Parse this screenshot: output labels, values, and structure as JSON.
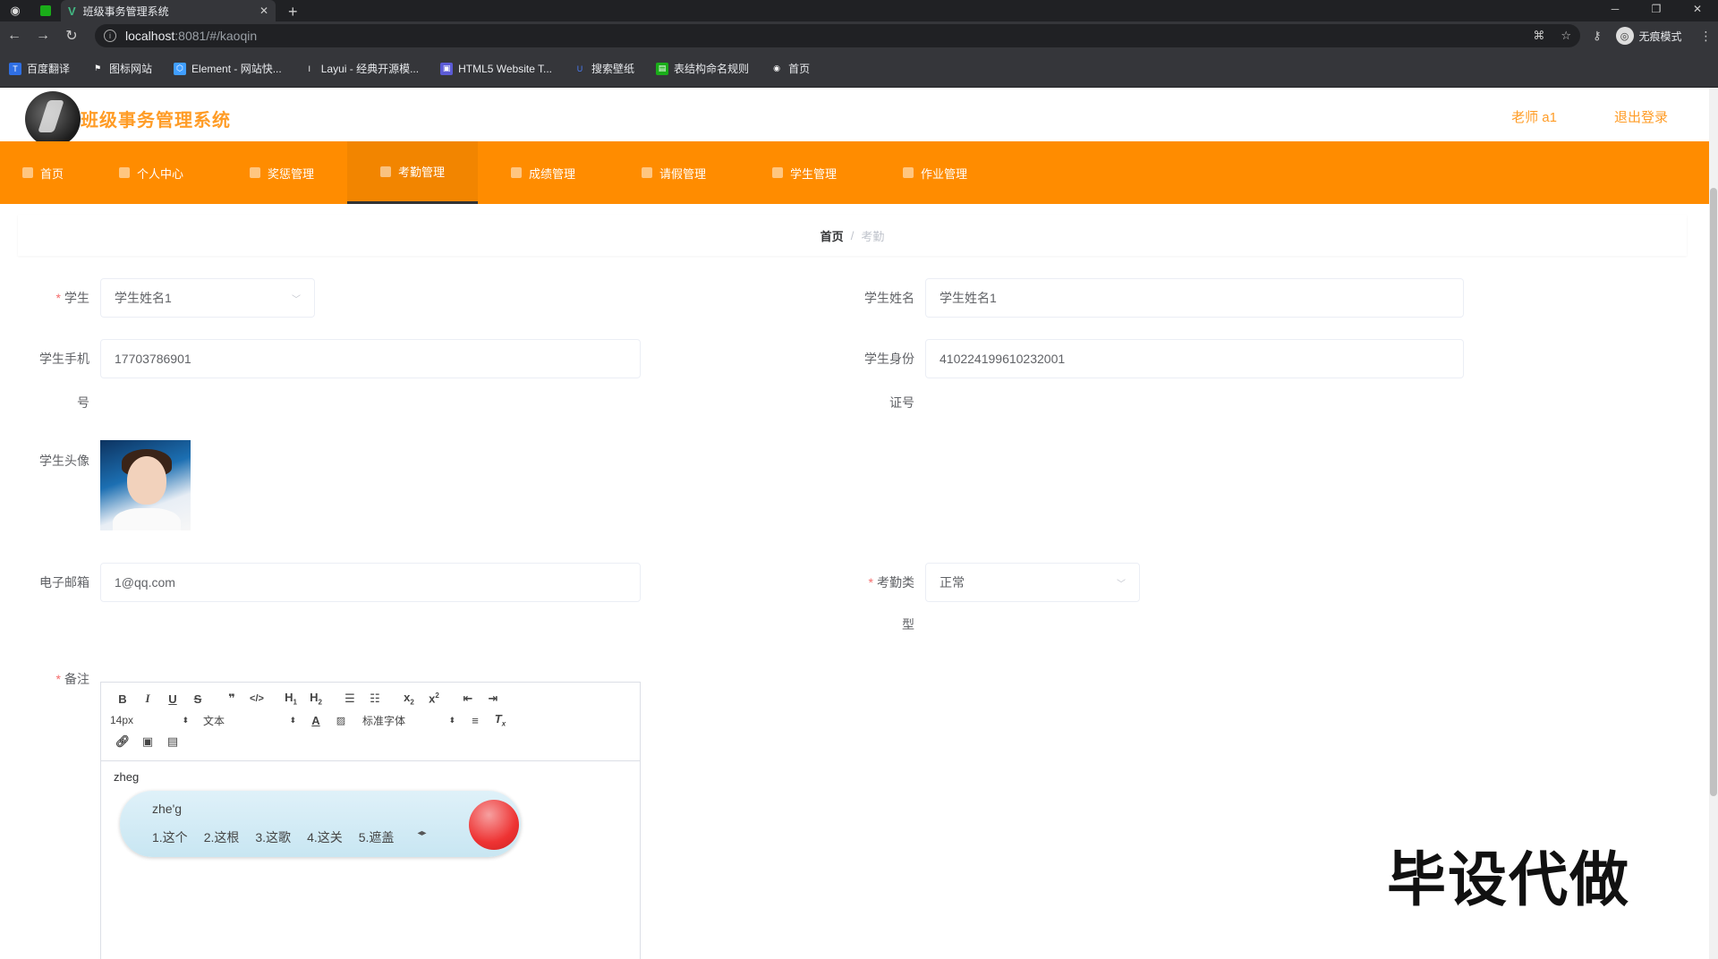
{
  "browser": {
    "tab_title": "班级事务管理系统",
    "url_host": "localhost",
    "url_rest": ":8081/#/kaoqin",
    "profile_label": "无痕模式",
    "bookmarks": [
      "百度翻译",
      "图标网站",
      "Element - 网站快...",
      "Layui - 经典开源模...",
      "HTML5 Website T...",
      "搜索壁纸",
      "表结构命名规则",
      "首页"
    ]
  },
  "header": {
    "title": "班级事务管理系统",
    "user": "老师 a1",
    "logout": "退出登录",
    "accent": "#ff8c00"
  },
  "nav": {
    "items": [
      "首页",
      "个人中心",
      "奖惩管理",
      "考勤管理",
      "成绩管理",
      "请假管理",
      "学生管理",
      "作业管理"
    ],
    "active": "考勤管理"
  },
  "breadcrumb": {
    "home": "首页",
    "sep": "/",
    "current": "考勤"
  },
  "form": {
    "student_label": "学生",
    "student_value": "学生姓名1",
    "name_label": "学生姓名",
    "name_value": "学生姓名1",
    "phone_label_1": "学生手机",
    "phone_label_2": "号",
    "phone_value": "17703786901",
    "id_label_1": "学生身份",
    "id_label_2": "证号",
    "id_value": "410224199610232001",
    "avatar_label": "学生头像",
    "email_label": "电子邮箱",
    "email_value": "1@qq.com",
    "type_label_1": "考勤类",
    "type_label_2": "型",
    "type_value": "正常",
    "remark_label": "备注"
  },
  "editor": {
    "font_size": "14px",
    "block": "文本",
    "font": "标准字体",
    "content": "zheg"
  },
  "ime": {
    "composition": "zhe'g",
    "candidates": [
      "1.这个",
      "2.这根",
      "3.这歌",
      "4.这关",
      "5.遮盖"
    ]
  },
  "watermark": "毕设代做"
}
